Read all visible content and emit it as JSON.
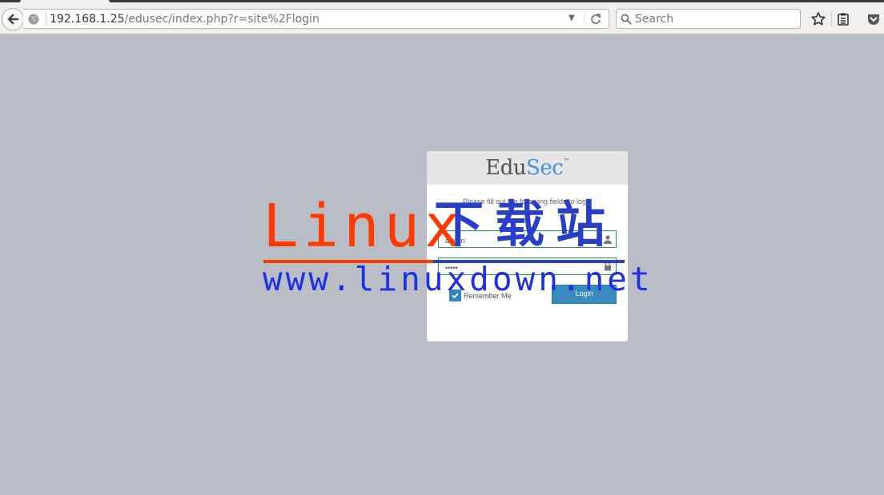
{
  "browser": {
    "url_host": "192.168.1.25",
    "url_path": "/edusec/index.php?r=site%2Flogin",
    "search_placeholder": "Search"
  },
  "login": {
    "logo_prefix": "Edu",
    "logo_suffix": "Sec",
    "logo_mark": "™",
    "message": "Please fill out the following fields to login",
    "username_value": "admin",
    "password_value": "•••••",
    "remember_label": "Remember Me",
    "remember_checked": true,
    "login_label": "Login"
  },
  "watermark": {
    "brand": "Linux",
    "chinese": "下载站",
    "site": "www.linuxdown.net"
  },
  "colors": {
    "background": "#b9bdc5",
    "accent_blue": "#3a8bbd",
    "field_border": "#1e9e5a",
    "watermark_red": "#ff3a00",
    "watermark_blue": "#2a3fc8"
  }
}
